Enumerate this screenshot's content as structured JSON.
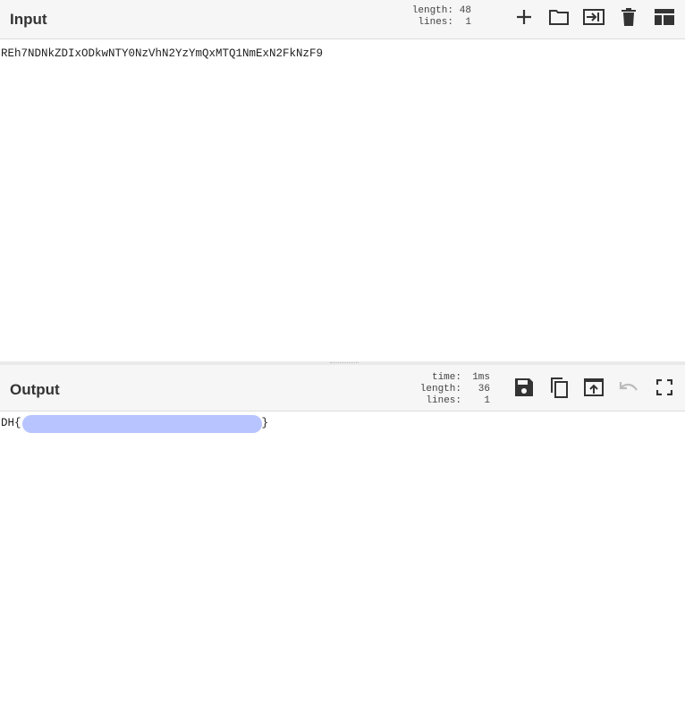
{
  "input": {
    "title": "Input",
    "stats": [
      {
        "key": "length:",
        "value": "48"
      },
      {
        "key": "lines:",
        "value": "1"
      }
    ],
    "text": "REh7NDNkZDIxODkwNTY0NzVhN2YzYmQxMTQ1NmExN2FkNzF9",
    "buttons": [
      "add-icon",
      "open-folder-icon",
      "load-file-icon",
      "delete-icon",
      "layout-icon"
    ]
  },
  "output": {
    "title": "Output",
    "stats": [
      {
        "key": "time:",
        "value": "1ms"
      },
      {
        "key": "length:",
        "value": "36"
      },
      {
        "key": "lines:",
        "value": "1"
      }
    ],
    "text_prefix": "DH{",
    "text_suffix": "}",
    "buttons": [
      "save-icon",
      "copy-icon",
      "replace-input-icon",
      "undo-icon",
      "fullscreen-icon"
    ]
  },
  "colors": {
    "header_bg": "#f6f6f6",
    "icon": "#333333",
    "icon_disabled": "#bbbbbb",
    "redaction": "#b3c1ff"
  }
}
